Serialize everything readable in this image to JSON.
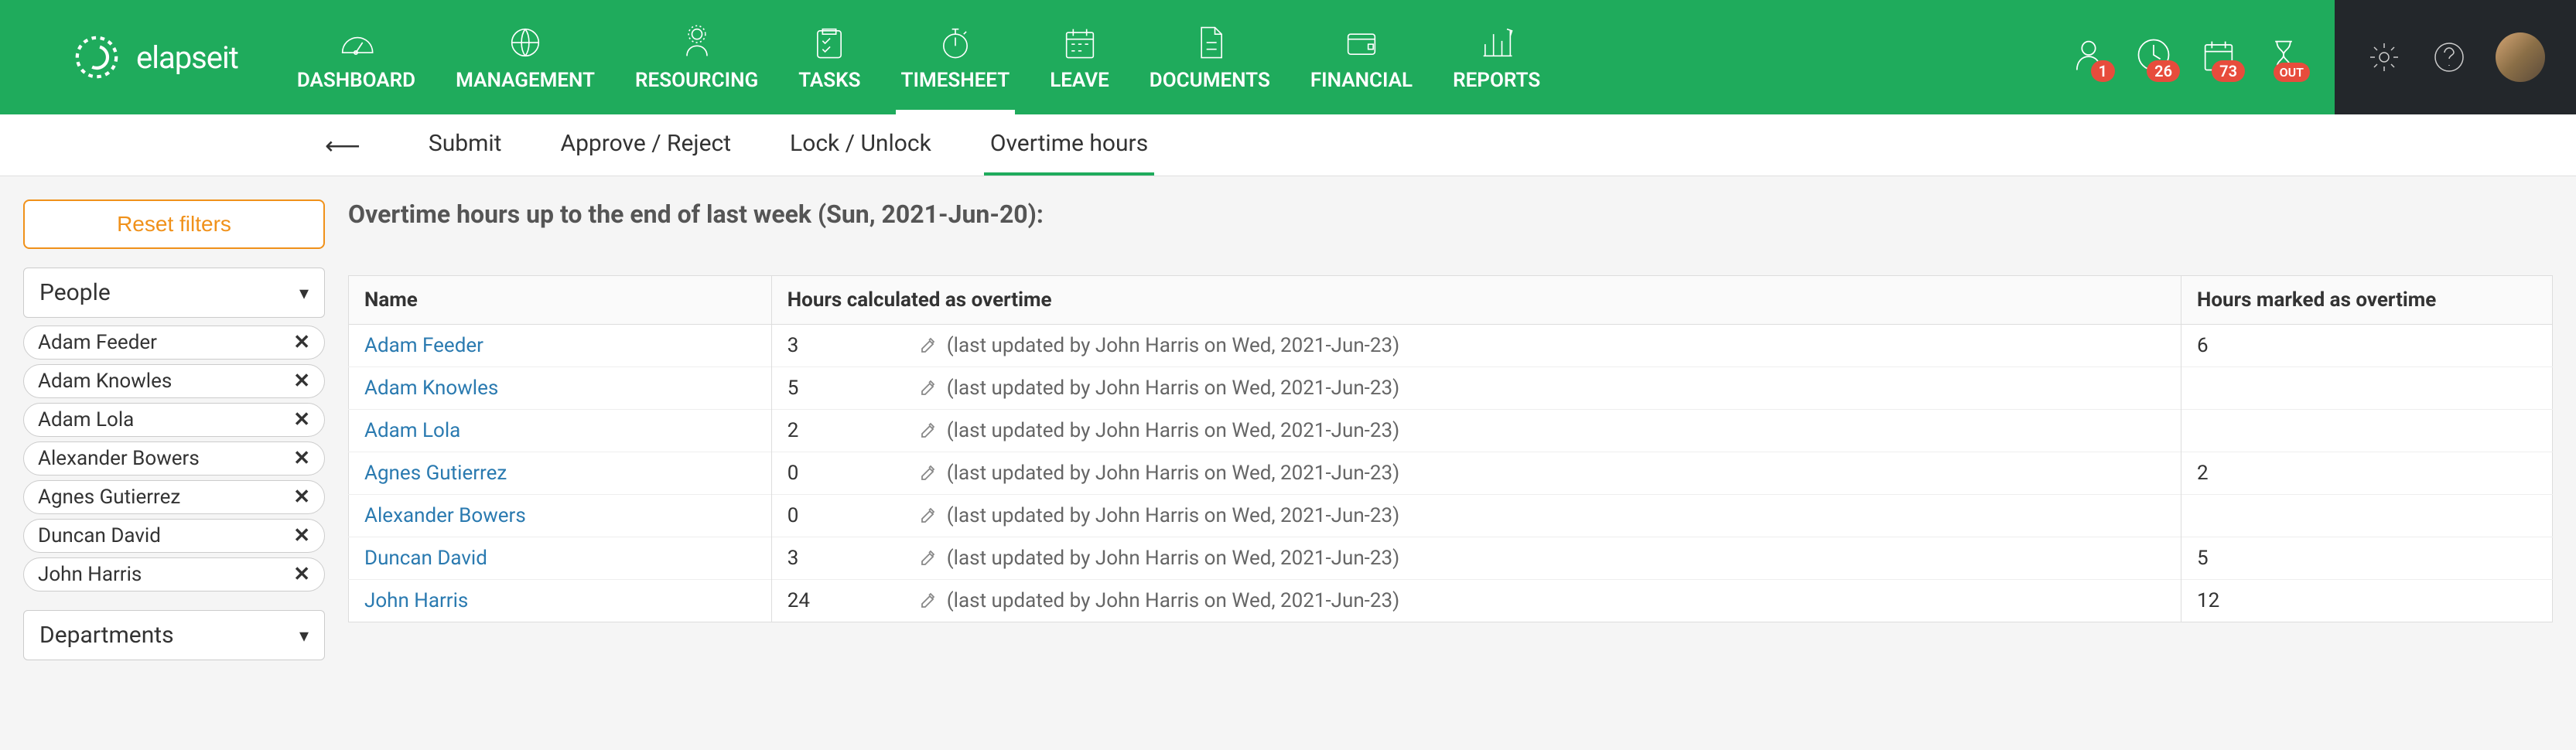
{
  "app": {
    "name": "elapseit"
  },
  "nav": [
    {
      "key": "dashboard",
      "label": "DASHBOARD"
    },
    {
      "key": "management",
      "label": "MANAGEMENT"
    },
    {
      "key": "resourcing",
      "label": "RESOURCING"
    },
    {
      "key": "tasks",
      "label": "TASKS"
    },
    {
      "key": "timesheet",
      "label": "TIMESHEET",
      "active": true
    },
    {
      "key": "leave",
      "label": "LEAVE"
    },
    {
      "key": "documents",
      "label": "DOCUMENTS"
    },
    {
      "key": "financial",
      "label": "FINANCIAL"
    },
    {
      "key": "reports",
      "label": "REPORTS"
    }
  ],
  "notifications": {
    "people": "1",
    "time": "26",
    "calendar": "73",
    "out": "OUT"
  },
  "subnav": {
    "items": [
      {
        "key": "submit",
        "label": "Submit"
      },
      {
        "key": "approve",
        "label": "Approve / Reject"
      },
      {
        "key": "lock",
        "label": "Lock / Unlock"
      },
      {
        "key": "overtime",
        "label": "Overtime hours",
        "active": true
      }
    ]
  },
  "filters": {
    "reset_label": "Reset filters",
    "people_label": "People",
    "departments_label": "Departments",
    "people": [
      "Adam Feeder",
      "Adam Knowles",
      "Adam Lola",
      "Alexander Bowers",
      "Agnes Gutierrez",
      "Duncan David",
      "John Harris"
    ]
  },
  "page_title": "Overtime hours up to the end of last week (Sun, 2021-Jun-20):",
  "table": {
    "headers": {
      "name": "Name",
      "calculated": "Hours calculated as overtime",
      "marked": "Hours marked as overtime"
    },
    "rows": [
      {
        "name": "Adam Feeder",
        "calc": "3",
        "updated": "(last updated by John Harris on Wed, 2021-Jun-23)",
        "marked": "6"
      },
      {
        "name": "Adam Knowles",
        "calc": "5",
        "updated": "(last updated by John Harris on Wed, 2021-Jun-23)",
        "marked": ""
      },
      {
        "name": "Adam Lola",
        "calc": "2",
        "updated": "(last updated by John Harris on Wed, 2021-Jun-23)",
        "marked": ""
      },
      {
        "name": "Agnes Gutierrez",
        "calc": "0",
        "updated": "(last updated by John Harris on Wed, 2021-Jun-23)",
        "marked": "2"
      },
      {
        "name": "Alexander Bowers",
        "calc": "0",
        "updated": "(last updated by John Harris on Wed, 2021-Jun-23)",
        "marked": ""
      },
      {
        "name": "Duncan David",
        "calc": "3",
        "updated": "(last updated by John Harris on Wed, 2021-Jun-23)",
        "marked": "5"
      },
      {
        "name": "John Harris",
        "calc": "24",
        "updated": "(last updated by John Harris on Wed, 2021-Jun-23)",
        "marked": "12"
      }
    ]
  }
}
